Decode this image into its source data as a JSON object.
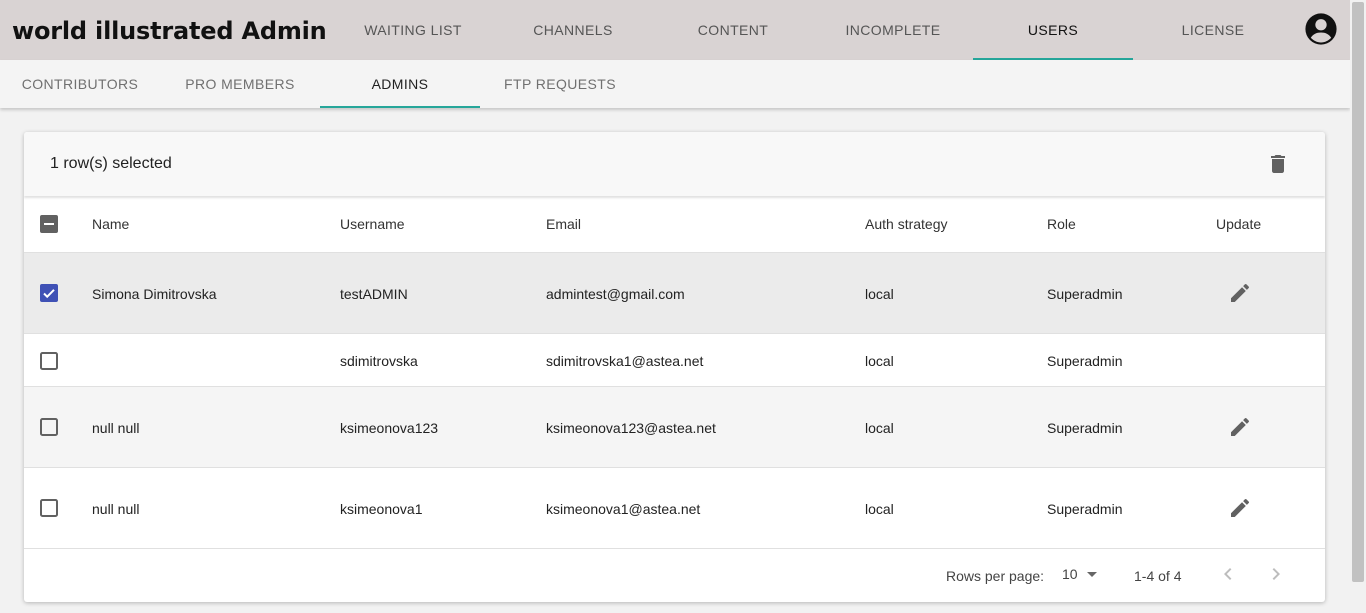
{
  "app": {
    "title": "world illustrated Admin"
  },
  "nav": {
    "tabs": [
      {
        "label": "WAITING LIST"
      },
      {
        "label": "CHANNELS"
      },
      {
        "label": "CONTENT"
      },
      {
        "label": "INCOMPLETE"
      },
      {
        "label": "USERS"
      },
      {
        "label": "LICENSE"
      }
    ],
    "active_tab": "USERS",
    "account_icon": "account-circle-icon"
  },
  "subnav": {
    "tabs": [
      {
        "label": "CONTRIBUTORS"
      },
      {
        "label": "PRO MEMBERS"
      },
      {
        "label": "ADMINS"
      },
      {
        "label": "FTP REQUESTS"
      }
    ],
    "active_tab": "ADMINS"
  },
  "toolbar": {
    "selection_text": "1 row(s) selected",
    "delete_icon": "trash-icon"
  },
  "table": {
    "headers": {
      "name": "Name",
      "username": "Username",
      "email": "Email",
      "auth": "Auth strategy",
      "role": "Role",
      "update": "Update"
    },
    "rows": [
      {
        "name": "Simona Dimitrovska",
        "username": "testADMIN",
        "email": "admintest@gmail.com",
        "auth": "local",
        "role": "Superadmin",
        "checked": true,
        "editable": true
      },
      {
        "name": "",
        "username": "sdimitrovska",
        "email": "sdimitrovska1@astea.net",
        "auth": "local",
        "role": "Superadmin",
        "checked": false,
        "editable": false
      },
      {
        "name": "null null",
        "username": "ksimeonova123",
        "email": "ksimeonova123@astea.net",
        "auth": "local",
        "role": "Superadmin",
        "checked": false,
        "editable": true
      },
      {
        "name": "null null",
        "username": "ksimeonova1",
        "email": "ksimeonova1@astea.net",
        "auth": "local",
        "role": "Superadmin",
        "checked": false,
        "editable": true
      }
    ]
  },
  "pagination": {
    "rows_per_page_label": "Rows per page:",
    "rows_per_page_value": "10",
    "range": "1-4 of 4"
  },
  "colors": {
    "accent": "#26a69a",
    "checkbox": "#3f51b5",
    "appbar": "#d9d3d3"
  }
}
